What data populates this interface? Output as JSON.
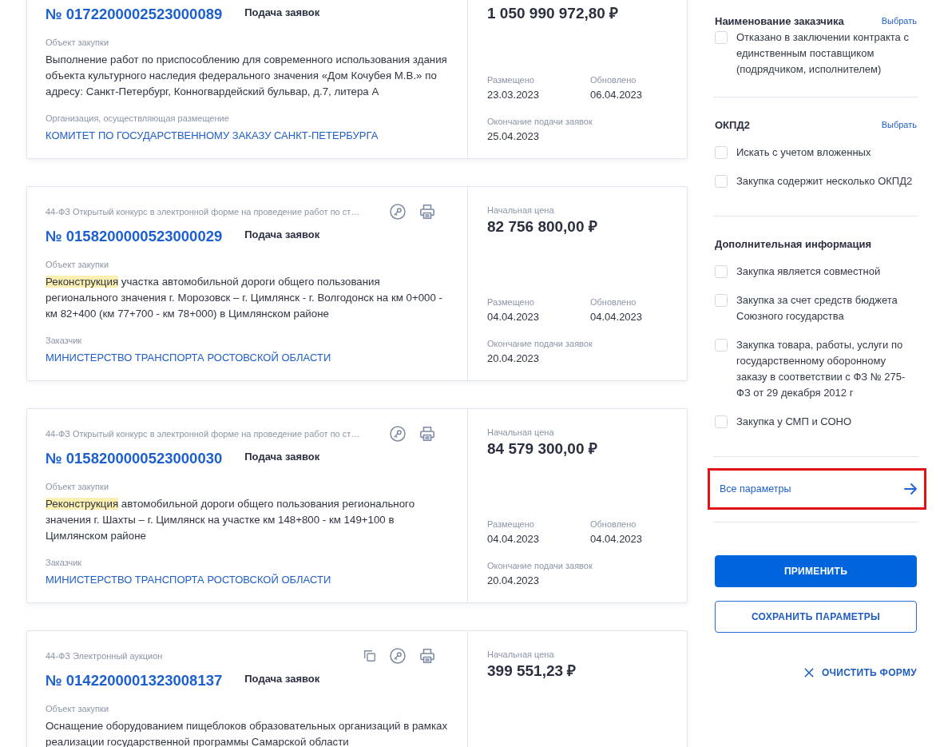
{
  "cards": [
    {
      "number": "№ 0172200002523000089",
      "status": "Подача заявок",
      "object_label": "Объект закупки",
      "object_description": [
        {
          "text": "Выполнение работ по приспособлению для современного использования здания объекта культурного наследия федерального значения «Дом Кочубея М.В.» по адресу: Санкт-Петербург, Конногвардейский бульвар, д.7, литера А",
          "highlighted": false
        }
      ],
      "org_label": "Организация, осуществляющая размещение",
      "org_name": "КОМИТЕТ ПО ГОСУДАРСТВЕННОМУ ЗАКАЗУ САНКТ-ПЕТЕРБУРГА",
      "price": "1 050 990 972,80 ₽",
      "posted_label": "Размещено",
      "posted": "23.03.2023",
      "updated_label": "Обновлено",
      "updated": "06.04.2023",
      "deadline_label": "Окончание подачи заявок",
      "deadline": "25.04.2023"
    },
    {
      "procedure": "44-ФЗ Открытый конкурс в электронной форме на проведение работ по ст…",
      "actions": [
        {
          "kind": "key"
        },
        {
          "kind": "print"
        }
      ],
      "number": "№ 0158200000523000029",
      "status": "Подача заявок",
      "object_label": "Объект закупки",
      "object_description": [
        {
          "text": "Реконструкция",
          "highlighted": true
        },
        {
          "text": " участка автомобильной дороги общего пользования регионального значения г. Морозовск – г. Цимлянск - г. Волгодонск на км 0+000 - км 82+400 (км 77+700 - км 78+000) в Цимлянском районе",
          "highlighted": false
        }
      ],
      "org_label": "Заказчик",
      "org_name": "МИНИСТЕРСТВО ТРАНСПОРТА РОСТОВСКОЙ ОБЛАСТИ",
      "price_label": "Начальная цена",
      "price": "82 756 800,00 ₽",
      "posted_label": "Размещено",
      "posted": "04.04.2023",
      "updated_label": "Обновлено",
      "updated": "04.04.2023",
      "deadline_label": "Окончание подачи заявок",
      "deadline": "20.04.2023"
    },
    {
      "procedure": "44-ФЗ Открытый конкурс в электронной форме на проведение работ по ст…",
      "actions": [
        {
          "kind": "key"
        },
        {
          "kind": "print"
        }
      ],
      "number": "№ 0158200000523000030",
      "status": "Подача заявок",
      "object_label": "Объект закупки",
      "object_description": [
        {
          "text": "Реконструкция",
          "highlighted": true
        },
        {
          "text": " автомобильной дороги общего пользования регионального значения г. Шахты – г. Цимлянск на участке км 148+800 - км 149+100 в Цимлянском районе",
          "highlighted": false
        }
      ],
      "org_label": "Заказчик",
      "org_name": "МИНИСТЕРСТВО ТРАНСПОРТА РОСТОВСКОЙ ОБЛАСТИ",
      "price_label": "Начальная цена",
      "price": "84 579 300,00 ₽",
      "posted_label": "Размещено",
      "posted": "04.04.2023",
      "updated_label": "Обновлено",
      "updated": "04.04.2023",
      "deadline_label": "Окончание подачи заявок",
      "deadline": "20.04.2023"
    },
    {
      "procedure": "44-ФЗ Электронный аукцион",
      "actions": [
        {
          "kind": "copy"
        },
        {
          "kind": "key"
        },
        {
          "kind": "print"
        }
      ],
      "number": "№ 0142200001323008137",
      "status": "Подача заявок",
      "object_label": "Объект закупки",
      "object_description": [
        {
          "text": "Оснащение оборудованием пищеблоков образовательных организаций в рамках реализации государственной программы Самарской области",
          "highlighted": false
        }
      ],
      "price_label": "Начальная цена",
      "price": "399 551,23 ₽"
    }
  ],
  "filters": {
    "sections": [
      {
        "title": "Наименование заказчика",
        "action": "Выбрать",
        "options": [
          {
            "label": "Отказано в заключении контракта с единственным поставщиком (подрядчиком, исполнителем)",
            "checked": false
          }
        ]
      },
      {
        "title": "ОКПД2",
        "action": "Выбрать",
        "options": [
          {
            "label": "Искать с учетом вложенных",
            "checked": false
          },
          {
            "label": "Закупка содержит несколько ОКПД2",
            "checked": false
          }
        ]
      },
      {
        "title": "Дополнительная информация",
        "options": [
          {
            "label": "Закупка является совместной",
            "checked": false
          },
          {
            "label": "Закупка за счет средств бюджета Союзного государства",
            "checked": false
          },
          {
            "label": "Закупка товара, работы, услуги по государственному оборонному заказу в соответствии с ФЗ № 275-ФЗ от 29 декабря 2012 г",
            "checked": false
          },
          {
            "label": "Закупка у СМП и СОНО",
            "checked": false
          }
        ]
      }
    ],
    "all_params": {
      "label": "Все параметры",
      "highlighted": true
    },
    "buttons": [
      {
        "label": "ПРИМЕНИТЬ",
        "kind": "primary"
      },
      {
        "label": "СОХРАНИТЬ ПАРАМЕТРЫ",
        "kind": "outline"
      }
    ],
    "clear": {
      "label": "ОЧИСТИТЬ ФОРМУ"
    }
  }
}
